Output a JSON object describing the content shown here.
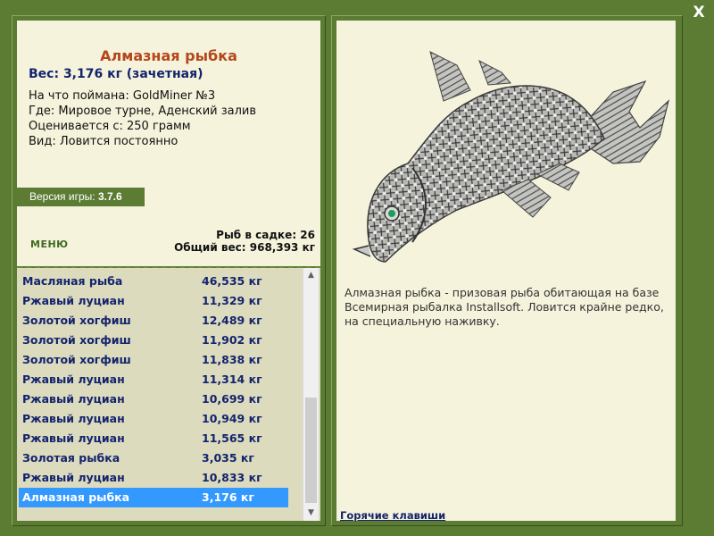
{
  "close_label": "X",
  "fish": {
    "title": "Алмазная рыбка",
    "weight": "Вес: 3,176 кг (зачетная)",
    "info": [
      "На что поймана: GoldMiner №3",
      "Где: Мировое турне, Аденский залив",
      "Оценивается с: 250 грамм",
      "Вид: Ловится постоянно"
    ],
    "description": "Алмазная рыбка - призовая рыба обитающая на базе Всемирная рыбалка Installsoft. Ловится крайне редко, на специальную наживку."
  },
  "version": {
    "label": "Версия игры:",
    "value": "3.7.6"
  },
  "menu_label": "МЕНЮ",
  "stats": {
    "count": "Рыб в садке: 26",
    "total": "Общий вес: 968,393 кг"
  },
  "fish_list": [
    {
      "name": "Масляная рыба",
      "weight": "46,535 кг"
    },
    {
      "name": "Ржавый луциан",
      "weight": "11,329 кг"
    },
    {
      "name": "Золотой хогфиш",
      "weight": "12,489 кг"
    },
    {
      "name": "Золотой хогфиш",
      "weight": "11,902 кг"
    },
    {
      "name": "Золотой хогфиш",
      "weight": "11,838 кг"
    },
    {
      "name": "Ржавый луциан",
      "weight": "11,314 кг"
    },
    {
      "name": "Ржавый луциан",
      "weight": "10,699 кг"
    },
    {
      "name": "Ржавый луциан",
      "weight": "10,949 кг"
    },
    {
      "name": "Ржавый луциан",
      "weight": "11,565 кг"
    },
    {
      "name": "Золотая рыбка",
      "weight": "3,035 кг"
    },
    {
      "name": "Ржавый луциан",
      "weight": "10,833 кг"
    },
    {
      "name": "Алмазная рыбка",
      "weight": "3,176 кг",
      "selected": true
    }
  ],
  "hotkeys_label": "Горячие клавиши",
  "icons": {
    "scroll_up": "scroll-up-icon",
    "scroll_down": "scroll-down-icon",
    "close": "close-icon"
  },
  "colors": {
    "frame": "#5b7c32",
    "panel": "#f5f3dc",
    "list_bg": "#dddbbd",
    "title": "#b4471b",
    "navy": "#13246e",
    "selection": "#3399ff"
  }
}
